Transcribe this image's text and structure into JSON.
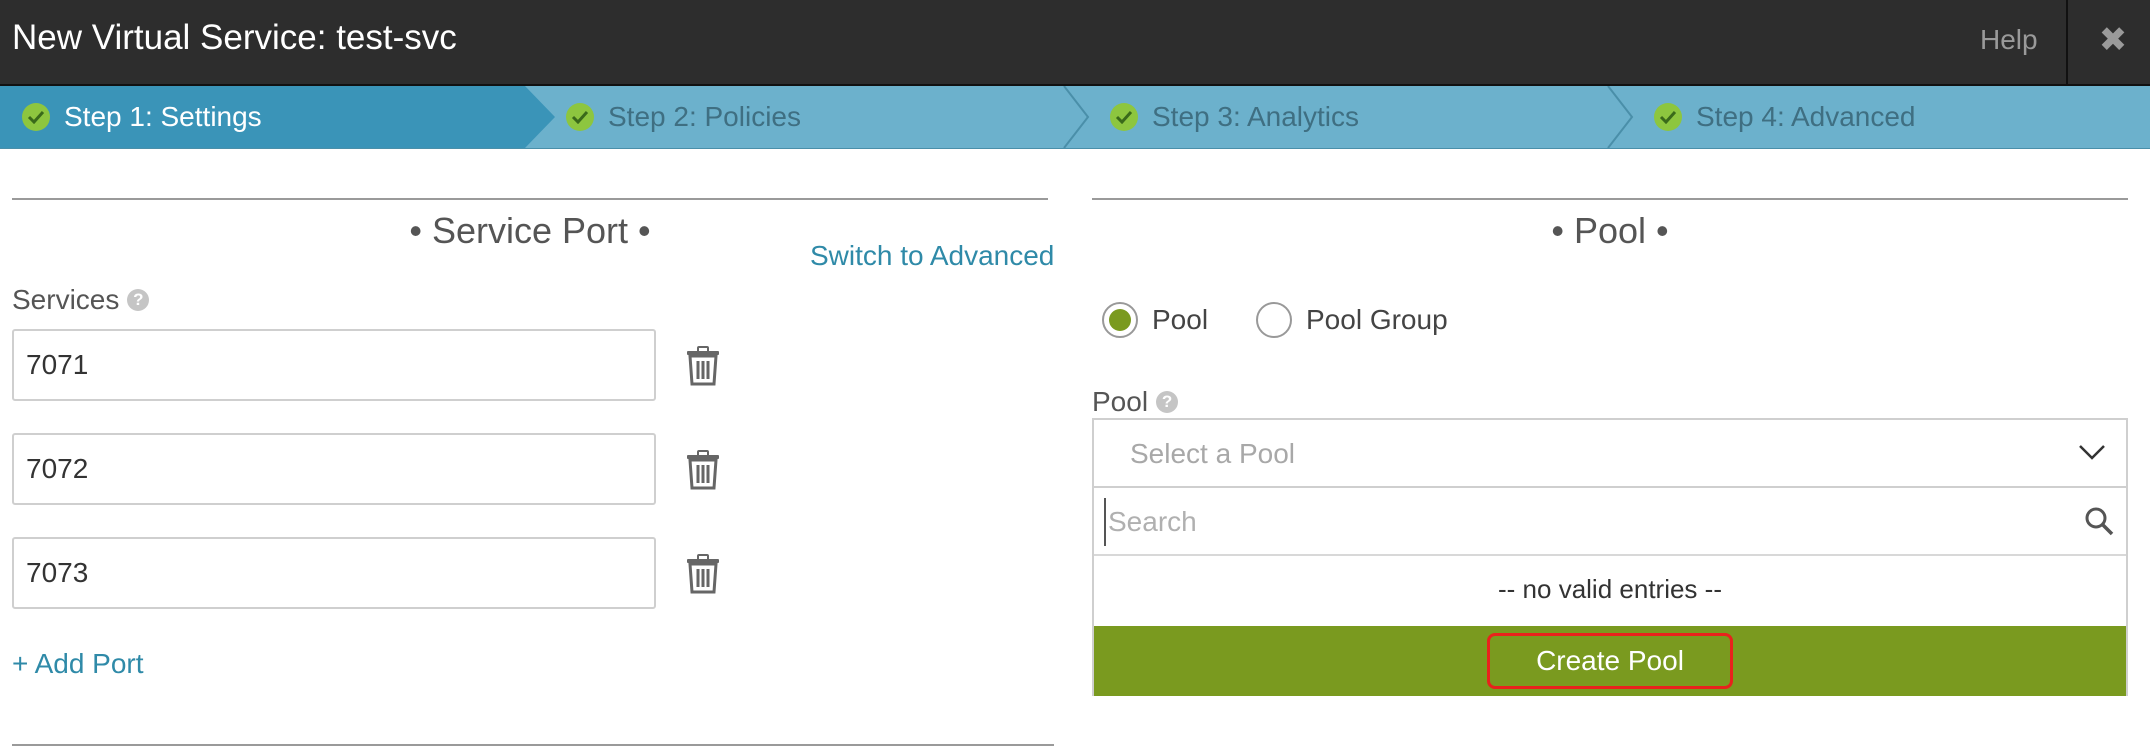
{
  "header": {
    "title": "New Virtual Service: test-svc",
    "help_label": "Help",
    "close_glyph": "✖"
  },
  "steps": [
    {
      "label": "Step 1: Settings",
      "active": true
    },
    {
      "label": "Step 2: Policies",
      "active": false
    },
    {
      "label": "Step 3: Analytics",
      "active": false
    },
    {
      "label": "Step 4: Advanced",
      "active": false
    }
  ],
  "service_port": {
    "section_title": "• Service Port •",
    "switch_link": "Switch to Advanced",
    "services_label": "Services",
    "ports": [
      "7071",
      "7072",
      "7073"
    ],
    "add_port_label": "+ Add Port"
  },
  "pool": {
    "section_title": "• Pool •",
    "radio_pool_label": "Pool",
    "radio_pool_group_label": "Pool Group",
    "selected_radio": "Pool",
    "pool_label": "Pool",
    "select_placeholder": "Select a Pool",
    "search_placeholder": "Search",
    "no_entries_text": "-- no valid entries --",
    "create_button_label": "Create Pool"
  },
  "colors": {
    "header_bg": "#2d2d2d",
    "steps_bg": "#6cb1cc",
    "step_active_bg": "#3a94b8",
    "accent_green": "#7a9a1f",
    "check_green": "#8dc63f",
    "link_blue": "#2f8aa8",
    "highlight_red": "#e8221c"
  },
  "icons": {
    "step_check": "check-circle-icon",
    "help": "question-circle-icon",
    "delete": "trash-icon",
    "search": "search-icon",
    "dropdown": "chevron-down-icon",
    "close": "close-icon"
  }
}
